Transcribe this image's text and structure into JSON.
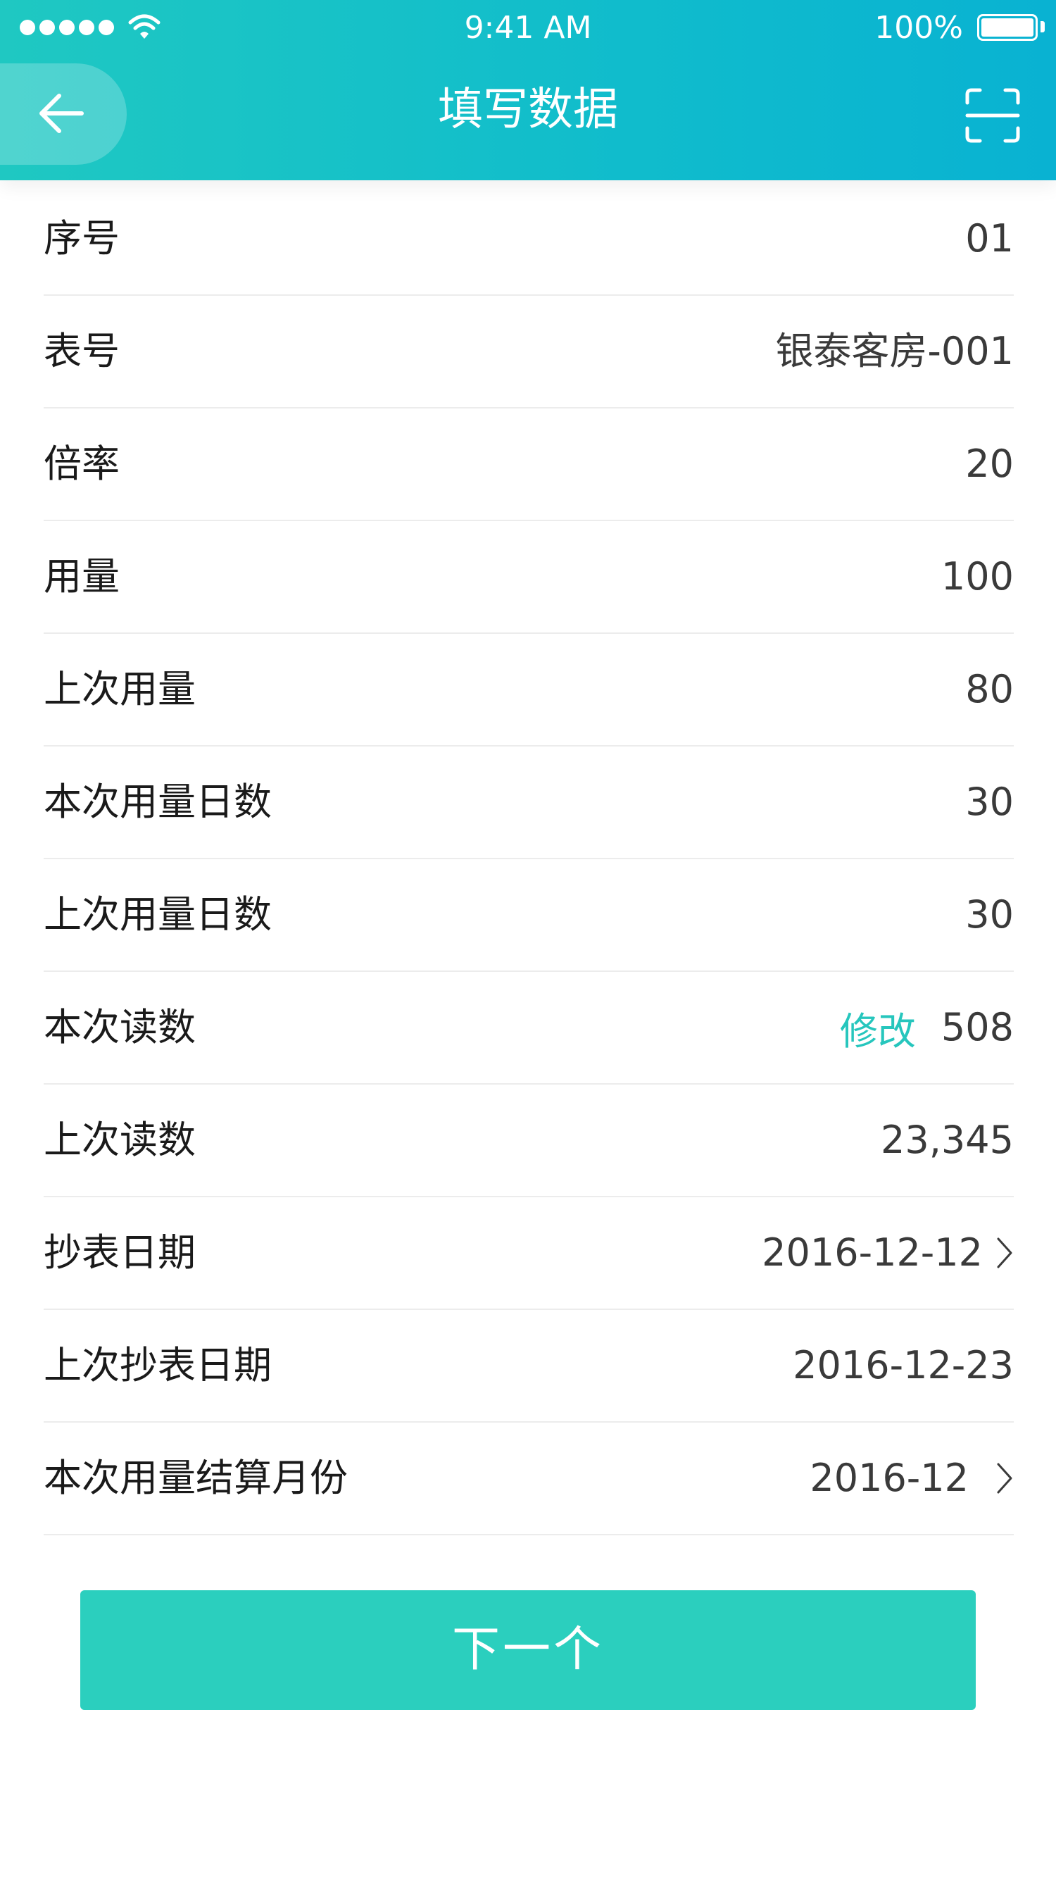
{
  "status_bar": {
    "time": "9:41 AM",
    "battery": "100%"
  },
  "header": {
    "title": "填写数据",
    "back_icon": "arrow-left-icon",
    "scan_icon": "scan-icon"
  },
  "form": {
    "rows": [
      {
        "label": "序号",
        "value": "01"
      },
      {
        "label": "表号",
        "value": "银泰客房-001"
      },
      {
        "label": "倍率",
        "value": "20"
      },
      {
        "label": "用量",
        "value": "100"
      },
      {
        "label": "上次用量",
        "value": "80"
      },
      {
        "label": "本次用量日数",
        "value": "30"
      },
      {
        "label": "上次用量日数",
        "value": "30"
      },
      {
        "label": "本次读数",
        "value": "508",
        "action": "修改"
      },
      {
        "label": "上次读数",
        "value": "23,345"
      },
      {
        "label": "抄表日期",
        "value": "2016-12-12"
      },
      {
        "label": "上次抄表日期",
        "value": "2016-12-23"
      },
      {
        "label": "本次用量结算月份",
        "value": "2016-12"
      }
    ]
  },
  "footer": {
    "next_label": "下一个"
  },
  "colors": {
    "header_start": "#1fc8c2",
    "header_end": "#09b2d2",
    "accent": "#26c6bd",
    "button": "#2bcfbe"
  }
}
